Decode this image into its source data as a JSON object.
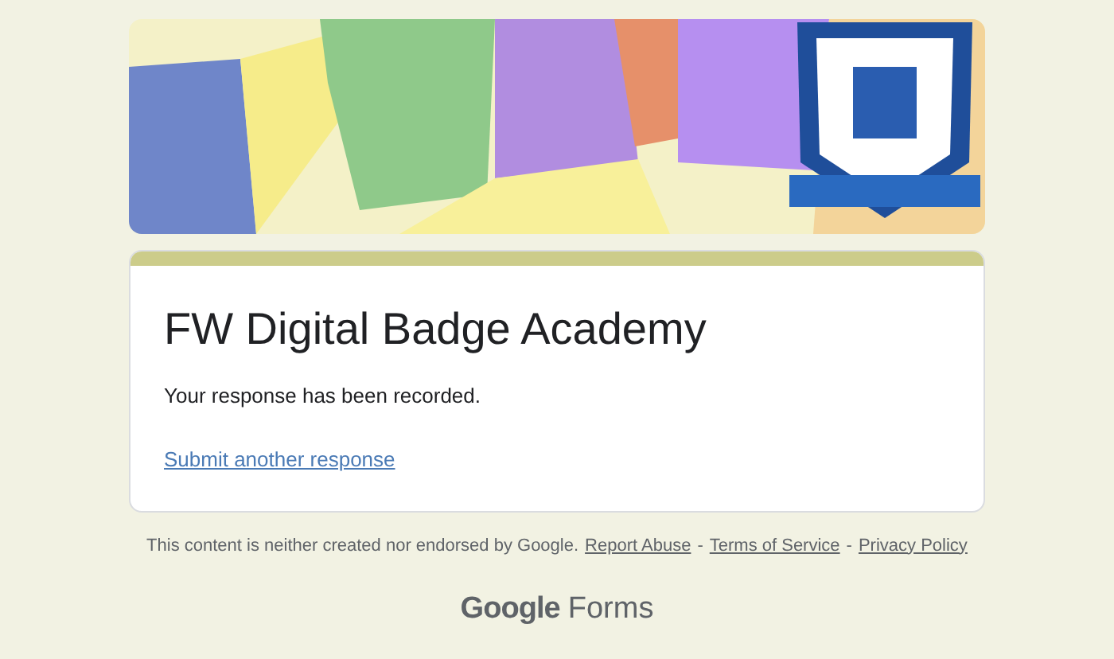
{
  "form": {
    "title": "FW Digital Badge Academy",
    "message": "Your response has been recorded.",
    "link": "Submit another response"
  },
  "footer": {
    "notice": "This content is neither created nor endorsed by Google.",
    "separator": "-",
    "links": [
      "Report Abuse",
      "Terms of Service",
      "Privacy Policy"
    ]
  },
  "logo": {
    "brand": "Google",
    "product": "Forms"
  }
}
